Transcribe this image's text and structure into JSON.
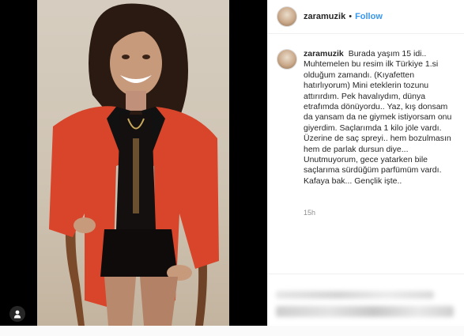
{
  "header": {
    "username": "zaramuzik",
    "separator": "•",
    "follow_label": "Follow",
    "more_icon": "more-options-icon"
  },
  "caption": {
    "username": "zaramuzik",
    "text": "Burada yaşım 15 idi.. Muhtemelen bu resim ilk Türkiye 1.si olduğum zamandı. (Kıyafetten hatırlıyorum) Mini eteklerin tozunu attırırdım. Pek havalıydım, dünya etrafımda dönüyordu.. Yaz, kış donsam da yansam da ne giymek istiyorsam onu giyerdim. Saçlarımda 1 kilo jöle vardı. Üzerine de saç spreyi.. hem bozulmasın hem de parlak dursun diye... Unutmuyorum, gece yatarken bile saçlarıma sürdüğüm parfümüm vardı. Kafaya bak... Gençlik işte..",
    "time": "15h"
  },
  "media": {
    "user_tag_icon": "user-tag-icon"
  },
  "colors": {
    "link": "#3897f0",
    "text": "#262626",
    "muted": "#8e8e8e",
    "jacket": "#d8452b"
  }
}
